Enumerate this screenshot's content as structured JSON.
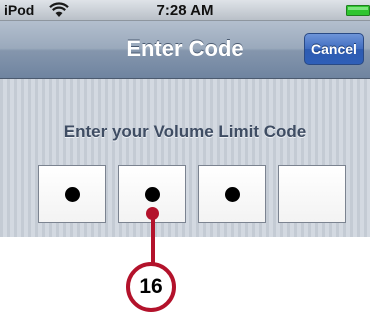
{
  "status_bar": {
    "carrier": "iPod",
    "time": "7:28 AM",
    "wifi_icon": "wifi-icon",
    "battery_icon": "battery-icon",
    "battery_color": "#2fc52f"
  },
  "nav_bar": {
    "title": "Enter Code",
    "cancel_label": "Cancel",
    "cancel_color": "#3f6cc0"
  },
  "content": {
    "prompt": "Enter your Volume Limit Code",
    "code_boxes": [
      {
        "filled": true
      },
      {
        "filled": true
      },
      {
        "filled": true
      },
      {
        "filled": false
      }
    ]
  },
  "callout": {
    "number": "16",
    "color": "#b3122b"
  }
}
